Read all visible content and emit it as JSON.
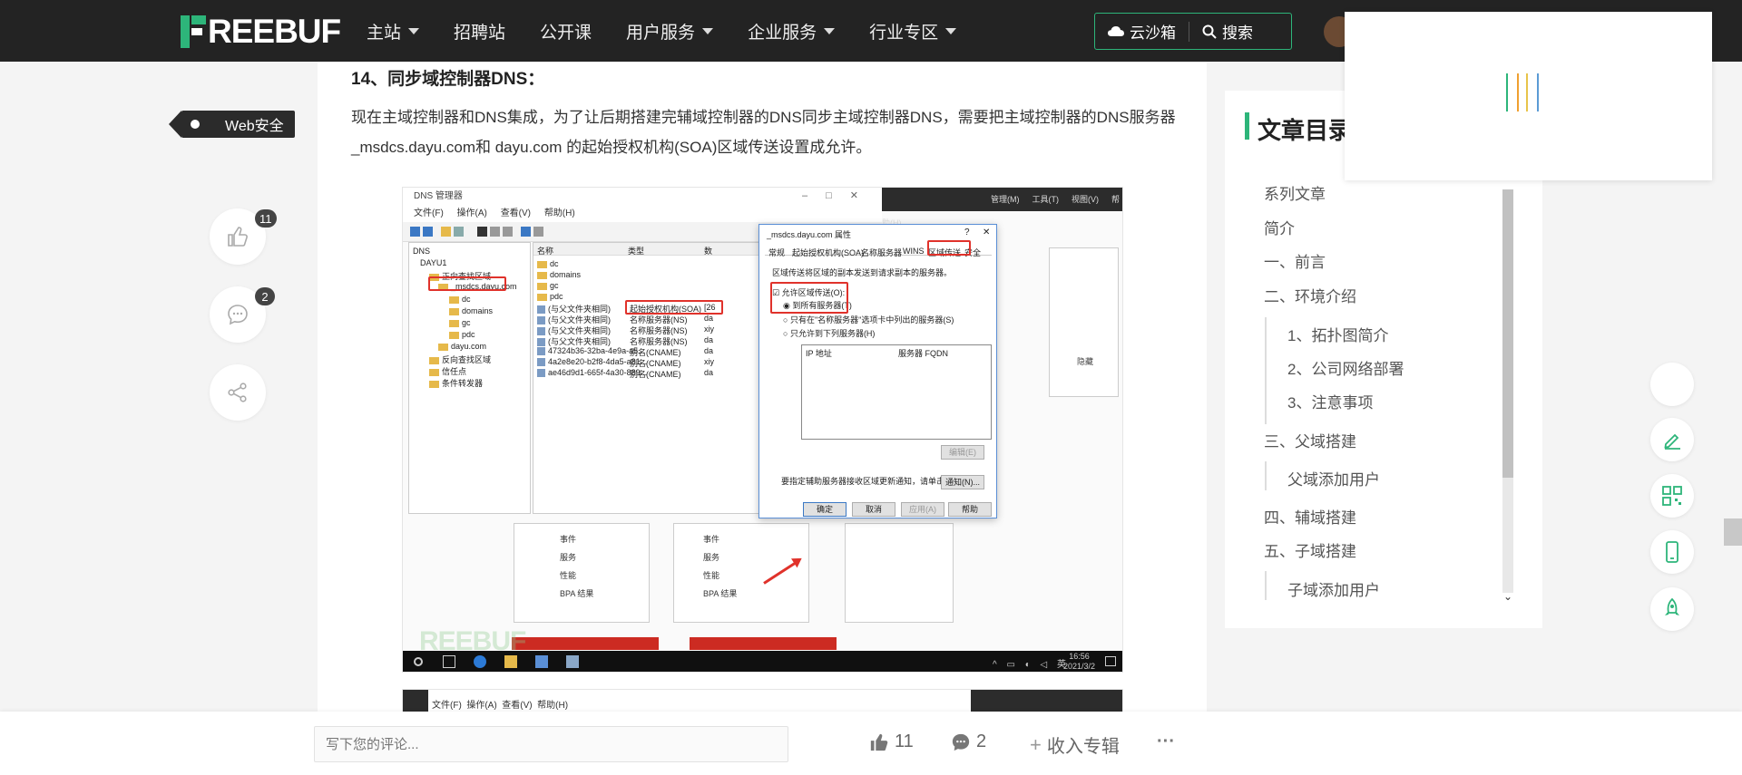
{
  "nav": {
    "logo_text": "REEBUF",
    "items": [
      {
        "label": "主站",
        "caret": true
      },
      {
        "label": "招聘站",
        "caret": false
      },
      {
        "label": "公开课",
        "caret": false
      },
      {
        "label": "用户服务",
        "caret": true
      },
      {
        "label": "企业服务",
        "caret": true
      },
      {
        "label": "行业专区",
        "caret": true
      }
    ],
    "cloud_label": "云沙箱",
    "search_label": "搜索"
  },
  "left": {
    "tag": "Web安全",
    "like_count": "11",
    "comment_count": "2"
  },
  "article": {
    "section_title": "14、同步域控制器DNS：",
    "paragraph": "现在主域控制器和DNS集成，为了让后期搭建完辅域控制器的DNS同步主域控制器DNS，需要把主域控制器的DNS服务器_msdcs.dayu.com和 dayu.com 的起始授权机构(SOA)区域传送设置成允许。"
  },
  "screenshot": {
    "window_title": "DNS 管理器",
    "menu": [
      "文件(F)",
      "操作(A)",
      "查看(V)",
      "帮助(H)"
    ],
    "dark_menu": [
      "管理(M)",
      "工具(T)",
      "视图(V)",
      "帮助(H)"
    ],
    "tree": [
      "DNS",
      "DAYU1",
      "正向查找区域",
      "_msdcs.dayu.com",
      "dc",
      "domains",
      "gc",
      "pdc",
      "dayu.com",
      "反向查找区域",
      "信任点",
      "条件转发器"
    ],
    "list_headers": [
      "名称",
      "类型",
      "数"
    ],
    "folders": [
      "dc",
      "domains",
      "gc",
      "pdc"
    ],
    "rows": [
      {
        "name": "(与父文件夹相同)",
        "type": "起始授权机构(SOA)",
        "extra": "[26"
      },
      {
        "name": "(与父文件夹相同)",
        "type": "名称服务器(NS)",
        "extra": "da"
      },
      {
        "name": "(与父文件夹相同)",
        "type": "名称服务器(NS)",
        "extra": "xiy"
      },
      {
        "name": "(与父文件夹相同)",
        "type": "名称服务器(NS)",
        "extra": "da"
      },
      {
        "name": "47324b36-32ba-4e9a-a5...",
        "type": "别名(CNAME)",
        "extra": "da"
      },
      {
        "name": "4a2e8e20-b2f8-4da5-a81...",
        "type": "别名(CNAME)",
        "extra": "xiy"
      },
      {
        "name": "ae46d9d1-665f-4a30-889...",
        "type": "别名(CNAME)",
        "extra": "da"
      }
    ],
    "panel_items": [
      "事件",
      "服务",
      "性能",
      "BPA 结果"
    ],
    "hide_label": "隐藏",
    "dialog": {
      "title": "_msdcs.dayu.com 属性",
      "help_glyph": "?",
      "close_glyph": "✕",
      "tabs": [
        "常规",
        "起始授权机构(SOA)",
        "名称服务器",
        "WINS",
        "区域传送",
        "安全"
      ],
      "desc": "区域传送将区域的副本发送到请求副本的服务器。",
      "allow_label": "允许区域传送(O):",
      "opt_all": "到所有服务器(T)",
      "opt_ns": "只有在\"名称服务器\"选项卡中列出的服务器(S)",
      "opt_list": "只允许到下列服务器(H)",
      "col_ip": "IP 地址",
      "col_fqdn": "服务器 FQDN",
      "edit_btn": "编辑(E)",
      "notify_text": "要指定辅助服务器接收区域更新通知，请单击\"通知\"。",
      "notify_btn": "通知(N)...",
      "ok": "确定",
      "cancel": "取消",
      "apply": "应用(A)",
      "help": "帮助"
    },
    "watermark": "REEBUF",
    "clock_time": "16:56",
    "clock_date": "2021/3/2",
    "tray_lang": "英"
  },
  "toc": {
    "title": "文章目录",
    "items": [
      {
        "label": "系列文章",
        "level": 1
      },
      {
        "label": "简介",
        "level": 1
      },
      {
        "label": "一、前言",
        "level": 1
      },
      {
        "label": "二、环境介绍",
        "level": 1
      },
      {
        "label": "1、拓扑图简介",
        "level": 2
      },
      {
        "label": "2、公司网络部署",
        "level": 2
      },
      {
        "label": "3、注意事项",
        "level": 2
      },
      {
        "label": "三、父域搭建",
        "level": 1
      },
      {
        "label": "父域添加用户",
        "level": 2
      },
      {
        "label": "四、辅域搭建",
        "level": 1
      },
      {
        "label": "五、子域搭建",
        "level": 1
      },
      {
        "label": "子域添加用户",
        "level": 2
      }
    ]
  },
  "bottom": {
    "comment_placeholder": "写下您的评论...",
    "like_count": "11",
    "comment_count": "2",
    "collect_label": "收入专辑",
    "more_label": "···"
  },
  "colors": {
    "accent": "#2db57a",
    "nav_bg": "#232323",
    "highlight_red": "#e0322b"
  }
}
